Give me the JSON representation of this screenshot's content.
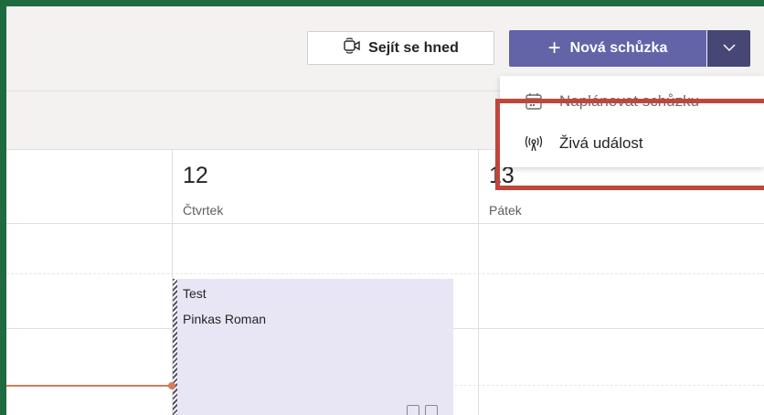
{
  "toolbar": {
    "meet_now_label": "Sejít se hned",
    "new_meeting_label": "Nová schůzka"
  },
  "dropdown": {
    "items": [
      {
        "label": "Naplánovat schůzku",
        "icon": "calendar-icon"
      },
      {
        "label": "Živá událost",
        "icon": "live-broadcast-icon"
      }
    ]
  },
  "calendar": {
    "days": [
      {
        "number": "12",
        "name": "Čtvrtek"
      },
      {
        "number": "13",
        "name": "Pátek"
      }
    ],
    "event": {
      "title": "Test",
      "organizer": "Pinkas Roman"
    }
  },
  "colors": {
    "brand": "#6264a7",
    "brand_dark": "#464775",
    "highlight": "#c0463a",
    "current_time": "#d97b5a",
    "event_bg": "#e8e6f4"
  }
}
